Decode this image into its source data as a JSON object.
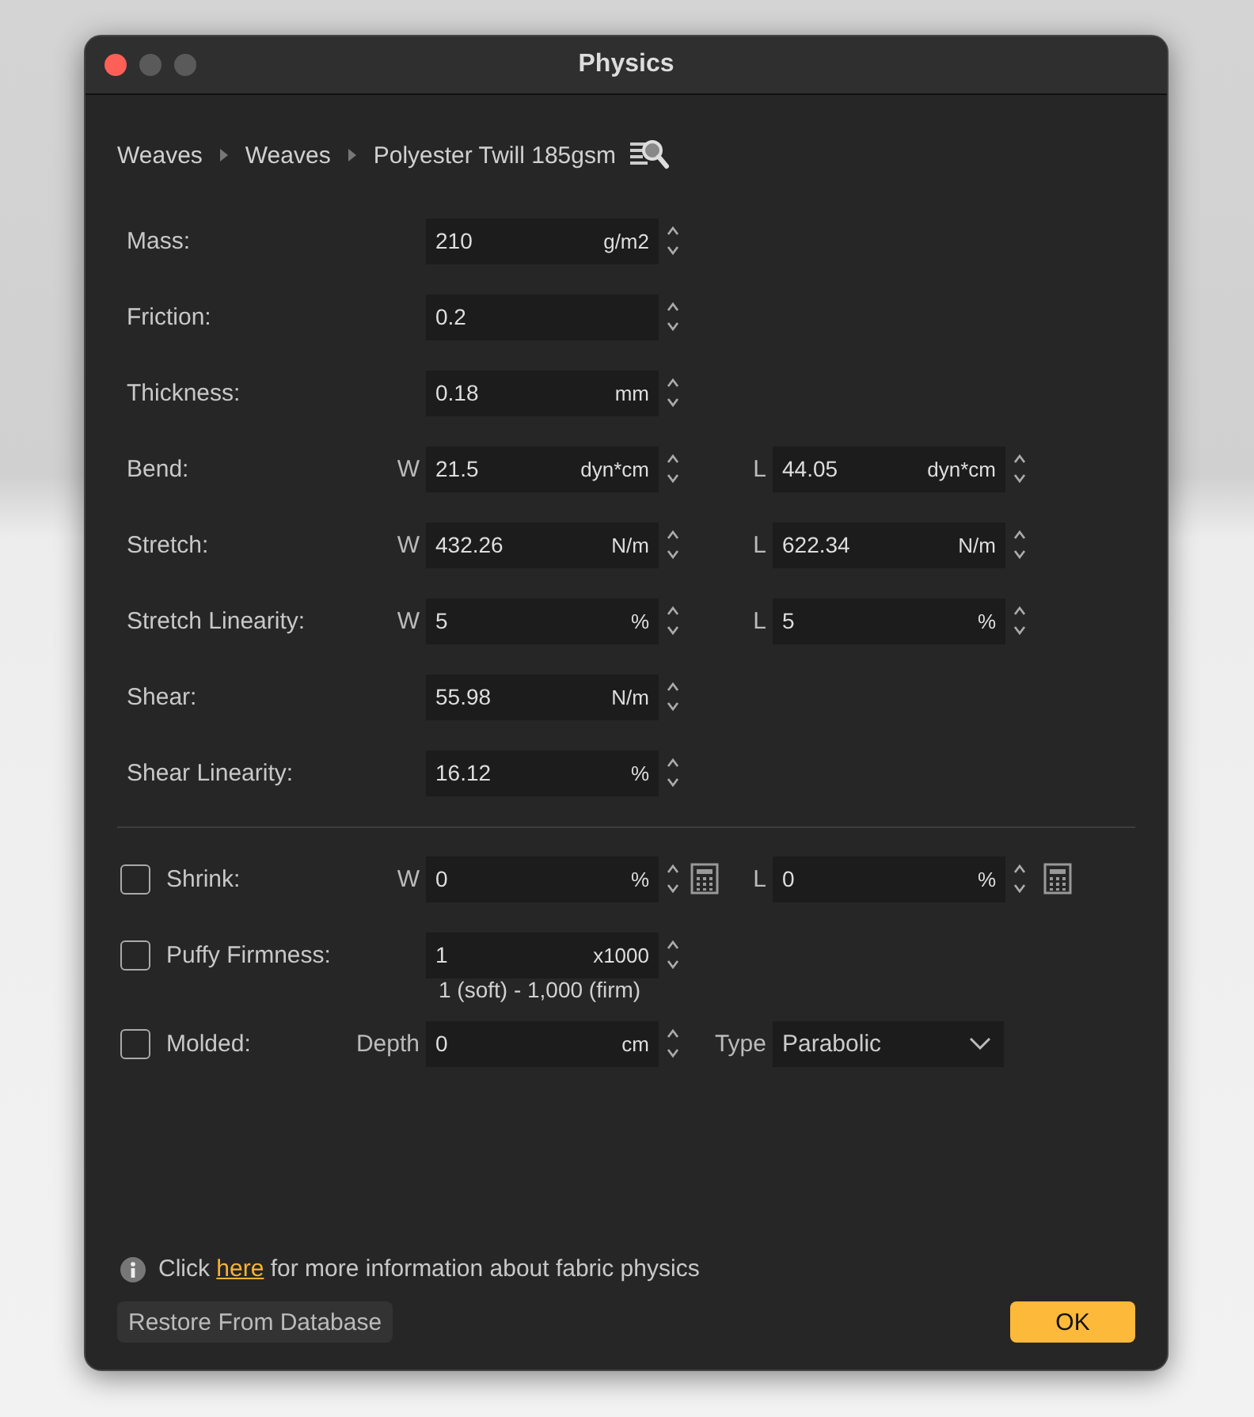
{
  "window": {
    "title": "Physics"
  },
  "breadcrumb": [
    "Weaves",
    "Weaves",
    "Polyester Twill 185gsm"
  ],
  "properties": [
    {
      "label": "Mass:",
      "fields": [
        {
          "kind": "spin",
          "value": "210",
          "unit": "g/m2"
        }
      ]
    },
    {
      "label": "Friction:",
      "fields": [
        {
          "kind": "spin",
          "value": "0.2"
        }
      ]
    },
    {
      "label": "Thickness:",
      "fields": [
        {
          "kind": "spin",
          "value": "0.18",
          "unit": "mm"
        }
      ]
    },
    {
      "label": "Bend:",
      "fields": [
        {
          "kind": "spin",
          "axis": "W",
          "value": "21.5",
          "unit": "dyn*cm"
        },
        {
          "kind": "spin",
          "axis": "L",
          "value": "44.05",
          "unit": "dyn*cm"
        }
      ]
    },
    {
      "label": "Stretch:",
      "fields": [
        {
          "kind": "spin",
          "axis": "W",
          "value": "432.26",
          "unit": "N/m"
        },
        {
          "kind": "spin",
          "axis": "L",
          "value": "622.34",
          "unit": "N/m"
        }
      ]
    },
    {
      "label": "Stretch Linearity:",
      "fields": [
        {
          "kind": "spin",
          "axis": "W",
          "value": "5",
          "unit": "%"
        },
        {
          "kind": "spin",
          "axis": "L",
          "value": "5",
          "unit": "%"
        }
      ]
    },
    {
      "label": "Shear:",
      "fields": [
        {
          "kind": "spin",
          "value": "55.98",
          "unit": "N/m"
        }
      ]
    },
    {
      "label": "Shear Linearity:",
      "fields": [
        {
          "kind": "spin",
          "value": "16.12",
          "unit": "%"
        }
      ]
    }
  ],
  "options": [
    {
      "label": "Shrink:",
      "checked": false,
      "fields": [
        {
          "kind": "calc",
          "axis": "W",
          "value": "0",
          "unit": "%"
        },
        {
          "kind": "calc",
          "axis": "L",
          "value": "0",
          "unit": "%"
        }
      ]
    },
    {
      "label": "Puffy Firmness:",
      "checked": false,
      "fields": [
        {
          "kind": "spin",
          "value": "1",
          "unit": "x1000"
        }
      ],
      "hint": "1 (soft) - 1,000 (firm)"
    },
    {
      "label": "Molded:",
      "checked": false,
      "fields": [
        {
          "kind": "spin",
          "axis": "Depth",
          "value": "0",
          "unit": "cm"
        },
        {
          "kind": "select",
          "axis": "Type",
          "value": "Parabolic"
        }
      ]
    }
  ],
  "info": {
    "before": "Click",
    "link": "here",
    "after": "for more information about fabric physics"
  },
  "buttons": [
    {
      "label": "Restore From Database",
      "kind": "secondary"
    },
    {
      "label": "OK",
      "kind": "primary"
    }
  ]
}
